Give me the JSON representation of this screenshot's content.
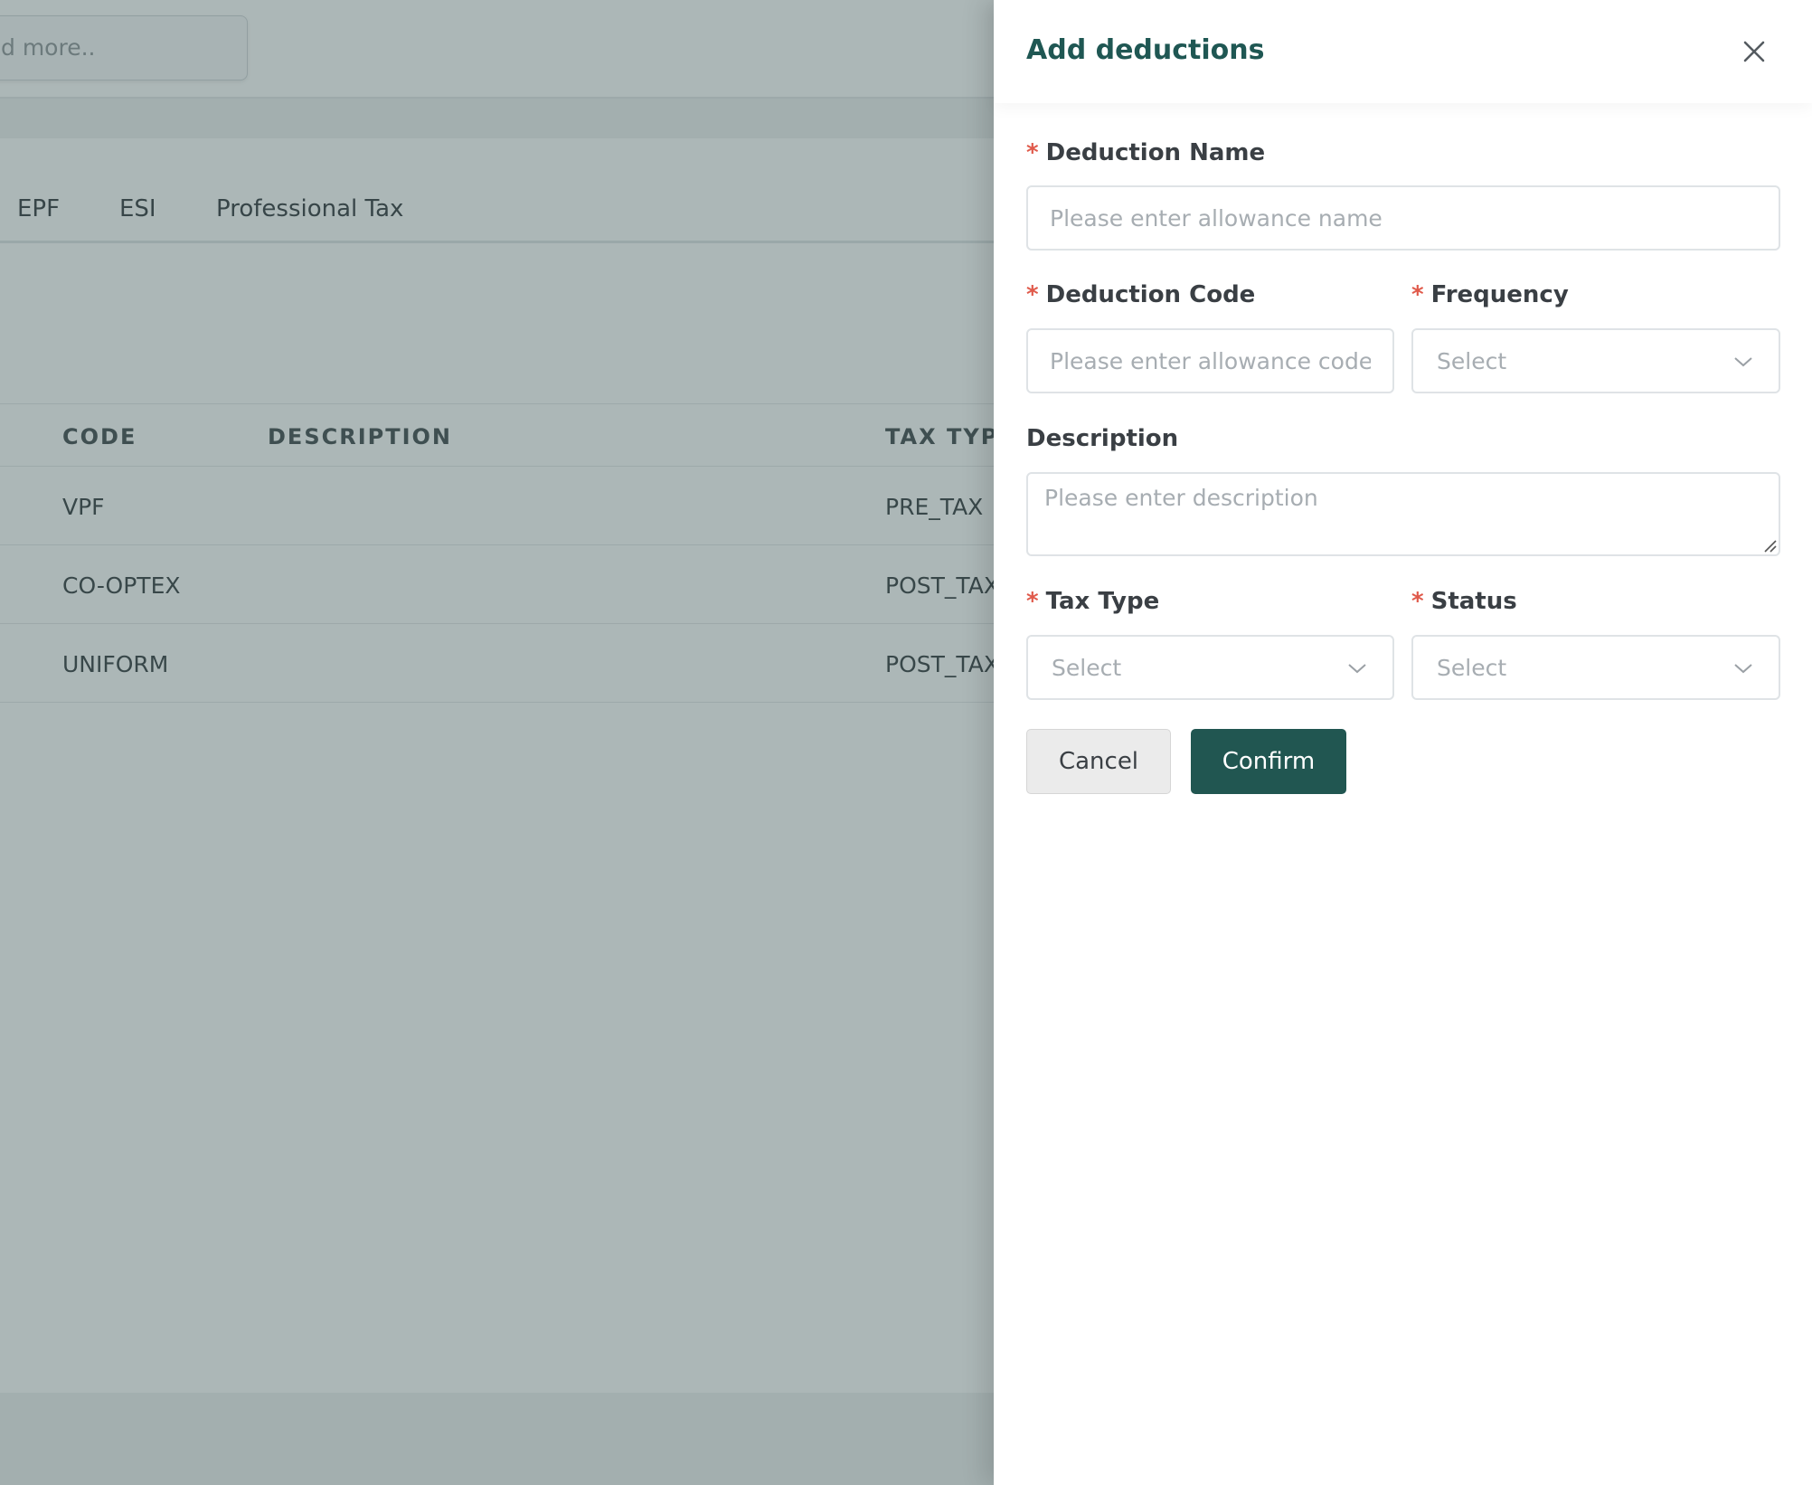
{
  "background": {
    "search_placeholder": "d more..",
    "tabs": [
      "EPF",
      "ESI",
      "Professional Tax"
    ],
    "table": {
      "headers": {
        "code": "CODE",
        "description": "DESCRIPTION",
        "tax_type": "TAX TYPE"
      },
      "rows": [
        {
          "code": "VPF",
          "description": "",
          "tax_type": "PRE_TAX"
        },
        {
          "code": "CO-OPTEX",
          "description": "",
          "tax_type": "POST_TAX"
        },
        {
          "code": "UNIFORM",
          "description": "",
          "tax_type": "POST_TAX"
        }
      ]
    }
  },
  "drawer": {
    "title": "Add deductions",
    "required_mark": "*",
    "fields": {
      "deduction_name": {
        "label": "Deduction Name",
        "placeholder": "Please enter allowance name"
      },
      "deduction_code": {
        "label": "Deduction Code",
        "placeholder": "Please enter allowance code"
      },
      "frequency": {
        "label": "Frequency",
        "value": "Select"
      },
      "description": {
        "label": "Description",
        "placeholder": "Please enter description"
      },
      "tax_type": {
        "label": "Tax Type",
        "value": "Select"
      },
      "status": {
        "label": "Status",
        "value": "Select"
      }
    },
    "buttons": {
      "cancel": "Cancel",
      "confirm": "Confirm"
    }
  },
  "colors": {
    "accent": "#215651",
    "title": "#1f5753",
    "required": "#e05a4b",
    "overlay": "#486060"
  },
  "icons": [
    "close-icon",
    "chevron-down-icon",
    "resize-grip-icon"
  ]
}
